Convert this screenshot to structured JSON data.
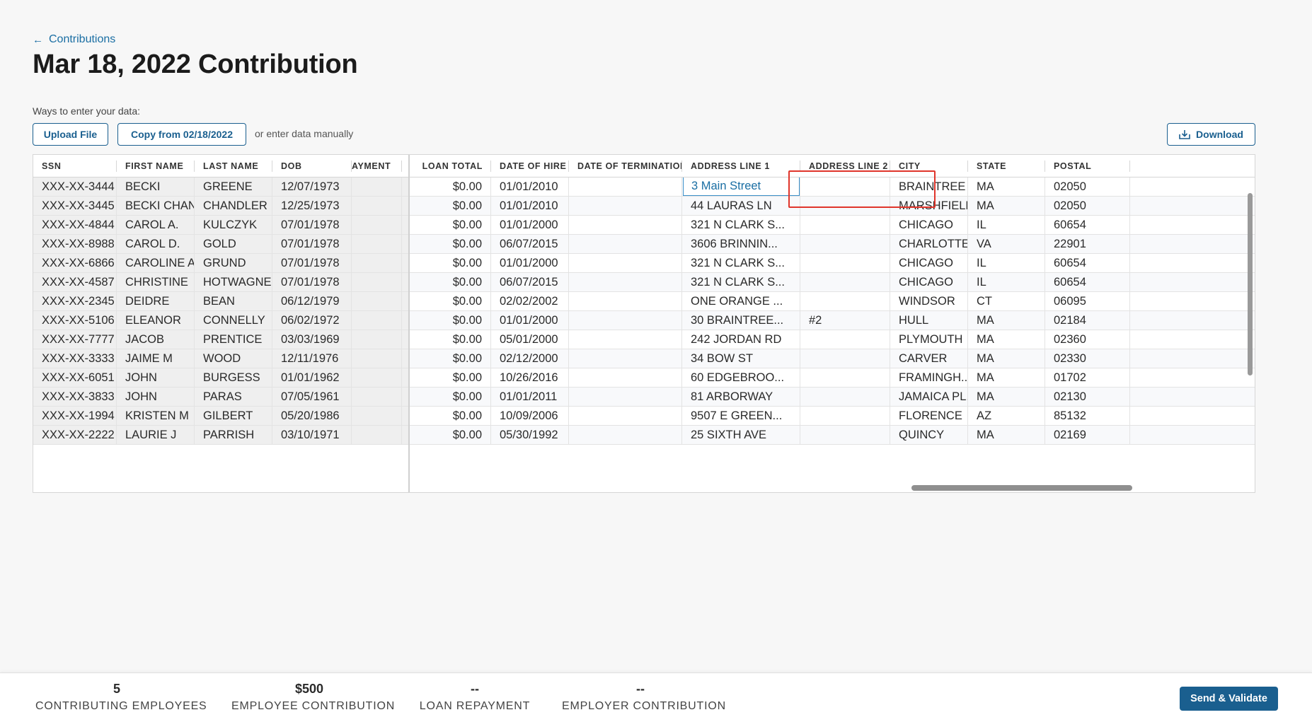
{
  "nav": {
    "back_label": "Contributions"
  },
  "page": {
    "title": "Mar 18, 2022 Contribution"
  },
  "entry": {
    "ways_label": "Ways to enter your data:",
    "upload_label": "Upload File",
    "copy_label": "Copy from 02/18/2022",
    "manual_text": "or enter data manually",
    "download_label": "Download"
  },
  "table": {
    "columns": [
      "SSN",
      "FIRST NAME",
      "LAST NAME",
      "DOB",
      "AYMENT",
      "LOAN TOTAL",
      "DATE OF HIRE",
      "DATE OF TERMINATION",
      "ADDRESS LINE 1",
      "ADDRESS LINE 2",
      "CITY",
      "STATE",
      "POSTAL"
    ],
    "editing_value": "3 Main Street",
    "rows": [
      [
        "XXX-XX-3444",
        "BECKI",
        "GREENE",
        "12/07/1973",
        "",
        "$0.00",
        "01/01/2010",
        "",
        "",
        "",
        "BRAINTREE",
        "MA",
        "02050"
      ],
      [
        "XXX-XX-3445",
        "BECKI CHAN",
        "CHANDLER",
        "12/25/1973",
        "",
        "$0.00",
        "01/01/2010",
        "",
        "44 LAURAS LN",
        "",
        "MARSHFIELD",
        "MA",
        "02050"
      ],
      [
        "XXX-XX-4844",
        "CAROL A.",
        "KULCZYK",
        "07/01/1978",
        "",
        "$0.00",
        "01/01/2000",
        "",
        "321 N CLARK S...",
        "",
        "CHICAGO",
        "IL",
        "60654"
      ],
      [
        "XXX-XX-8988",
        "CAROL D.",
        "GOLD",
        "07/01/1978",
        "",
        "$0.00",
        "06/07/2015",
        "",
        "3606 BRINNIN...",
        "",
        "CHARLOTTE...",
        "VA",
        "22901"
      ],
      [
        "XXX-XX-6866",
        "CAROLINE A.",
        "GRUND",
        "07/01/1978",
        "",
        "$0.00",
        "01/01/2000",
        "",
        "321 N CLARK S...",
        "",
        "CHICAGO",
        "IL",
        "60654"
      ],
      [
        "XXX-XX-4587",
        "CHRISTINE",
        "HOTWAGNER",
        "07/01/1978",
        "",
        "$0.00",
        "06/07/2015",
        "",
        "321 N CLARK S...",
        "",
        "CHICAGO",
        "IL",
        "60654"
      ],
      [
        "XXX-XX-2345",
        "DEIDRE",
        "BEAN",
        "06/12/1979",
        "",
        "$0.00",
        "02/02/2002",
        "",
        "ONE ORANGE ...",
        "",
        "WINDSOR",
        "CT",
        "06095"
      ],
      [
        "XXX-XX-5106",
        "ELEANOR",
        "CONNELLY",
        "06/02/1972",
        "",
        "$0.00",
        "01/01/2000",
        "",
        "30 BRAINTREE...",
        "#2",
        "HULL",
        "MA",
        "02184"
      ],
      [
        "XXX-XX-7777",
        "JACOB",
        "PRENTICE",
        "03/03/1969",
        "",
        "$0.00",
        "05/01/2000",
        "",
        "242 JORDAN RD",
        "",
        "PLYMOUTH",
        "MA",
        "02360"
      ],
      [
        "XXX-XX-3333",
        "JAIME M",
        "WOOD",
        "12/11/1976",
        "",
        "$0.00",
        "02/12/2000",
        "",
        "34 BOW ST",
        "",
        "CARVER",
        "MA",
        "02330"
      ],
      [
        "XXX-XX-6051",
        "JOHN",
        "BURGESS",
        "01/01/1962",
        "",
        "$0.00",
        "10/26/2016",
        "",
        "60 EDGEBROO...",
        "",
        "FRAMINGH...",
        "MA",
        "01702"
      ],
      [
        "XXX-XX-3833",
        "JOHN",
        "PARAS",
        "07/05/1961",
        "",
        "$0.00",
        "01/01/2011",
        "",
        "81 ARBORWAY",
        "",
        "JAMAICA PL...",
        "MA",
        "02130"
      ],
      [
        "XXX-XX-1994",
        "KRISTEN M",
        "GILBERT",
        "05/20/1986",
        "",
        "$0.00",
        "10/09/2006",
        "",
        "9507 E GREEN...",
        "",
        "FLORENCE",
        "AZ",
        "85132"
      ],
      [
        "XXX-XX-2222",
        "LAURIE J",
        "PARRISH",
        "03/10/1971",
        "",
        "$0.00",
        "05/30/1992",
        "",
        "25 SIXTH AVE",
        "",
        "QUINCY",
        "MA",
        "02169"
      ]
    ]
  },
  "summary": {
    "contributing_employees_value": "5",
    "contributing_employees_label": "CONTRIBUTING EMPLOYEES",
    "employee_contribution_value": "$500",
    "employee_contribution_label": "EMPLOYEE CONTRIBUTION",
    "loan_repayment_value": "--",
    "loan_repayment_label": "LOAN REPAYMENT",
    "employer_contribution_value": "--",
    "employer_contribution_label": "EMPLOYER CONTRIBUTION",
    "send_label": "Send & Validate"
  },
  "colors": {
    "accent": "#1a5f8f",
    "link": "#1a6ea3",
    "highlight": "#e0352b"
  }
}
